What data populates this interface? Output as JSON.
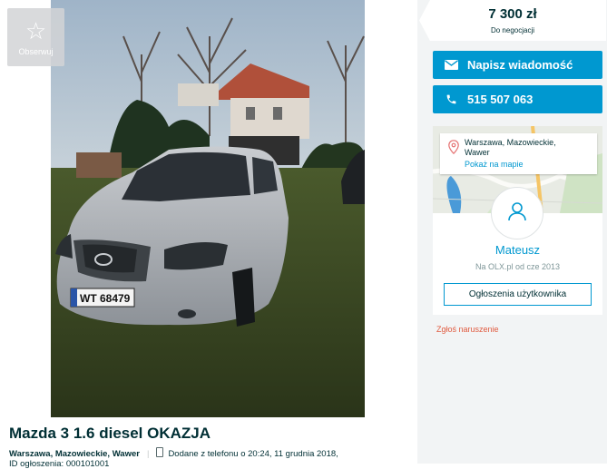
{
  "listing": {
    "observe_label": "Obserwuj",
    "title": "Mazda 3 1.6 diesel OKAZJA",
    "location": "Warszawa, Mazowieckie, Wawer",
    "added_text": "Dodane z telefonu",
    "added_time": "o 20:24, 11 grudnia 2018,",
    "id_text": "ID ogłoszenia: 000101001"
  },
  "photo": {
    "plate_text": "WT 68479"
  },
  "price": {
    "amount": "7 300 zł",
    "note": "Do negocjacji"
  },
  "actions": {
    "message_label": "Napisz wiadomość",
    "phone_label": "515 507 063"
  },
  "seller": {
    "address_line1": "Warszawa, Mazowieckie,",
    "address_line2": "Wawer",
    "show_on_map": "Pokaż na mapie",
    "name": "Mateusz",
    "member_since": "Na OLX.pl od cze 2013",
    "ads_button": "Ogłoszenia użytkownika"
  },
  "report_label": "Zgłoś naruszenie",
  "icons": {
    "observe": "star-icon",
    "message": "envelope-icon",
    "phone": "phone-icon",
    "pin": "map-pin-icon",
    "avatar": "user-icon",
    "device": "mobile-device-icon"
  },
  "colors": {
    "accent": "#0098d0",
    "text": "#002f34",
    "report": "#e05a3f",
    "sidebar_bg": "#f2f4f5"
  }
}
